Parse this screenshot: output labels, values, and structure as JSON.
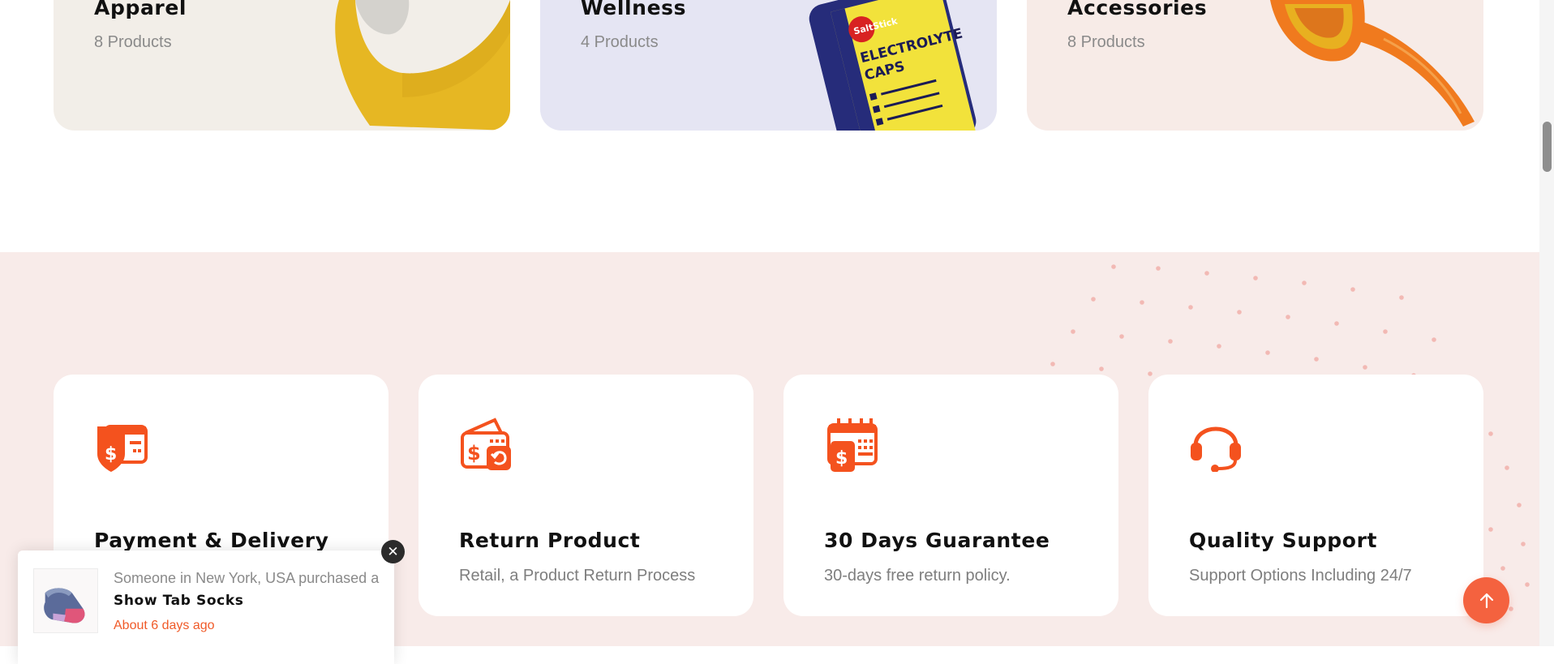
{
  "colors": {
    "accent": "#f4623f",
    "band_bg": "#f8ebe9"
  },
  "categories": [
    {
      "title": "Apparel",
      "count": "8 Products",
      "bg": "#f2eee8",
      "image_icon": "yellow-sports-bra-image"
    },
    {
      "title": "Wellness",
      "count": "4 Products",
      "bg": "#e5e5f3",
      "image_icon": "electrolyte-caps-bottle-image"
    },
    {
      "title": "Accessories",
      "count": "8 Products",
      "bg": "#f7ebe7",
      "image_icon": "orange-sunglasses-image"
    }
  ],
  "bottle_label": {
    "brand": "SaltStick",
    "line1": "ELECTROLYTE",
    "line2": "CAPS"
  },
  "features": [
    {
      "title": "Payment & Delivery",
      "desc": "",
      "icon": "payment-shield-icon"
    },
    {
      "title": "Return Product",
      "desc": "Retail, a Product Return Process",
      "icon": "return-wallet-icon"
    },
    {
      "title": "30 Days Guarantee",
      "desc": "30-days free return policy.",
      "icon": "calendar-guarantee-icon"
    },
    {
      "title": "Quality Support",
      "desc": "Support Options Including 24/7",
      "icon": "headset-support-icon"
    }
  ],
  "popup": {
    "line1": "Someone in New York, USA purchased a",
    "product": "Show Tab Socks",
    "time": "About 6 days ago",
    "close_symbol": "✕"
  }
}
